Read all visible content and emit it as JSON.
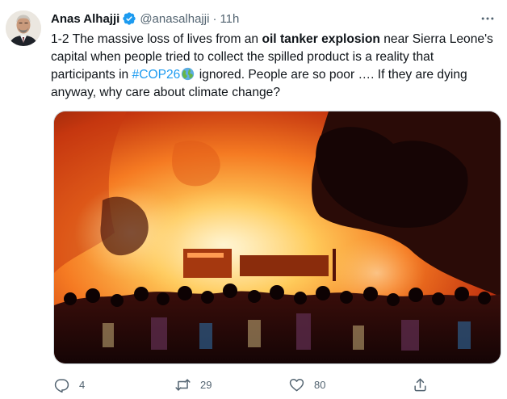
{
  "tweet": {
    "author_name": "Anas Alhajji",
    "handle": "@anasalhajji",
    "separator": "·",
    "time": "11h",
    "text_parts": {
      "p1": "1-2 The massive loss of lives from an ",
      "p2_bold": "oil tanker explosion",
      "p3": " near Sierra Leone's capital when people tried to collect the spilled product is a reality that participants in ",
      "p4_hashtag": "#COP26",
      "p5": " ignored. People are so poor …. If they are dying anyway, why care about climate change?"
    }
  },
  "actions": {
    "reply_count": "4",
    "retweet_count": "29",
    "like_count": "80"
  },
  "icons": {
    "verified": "verified-badge-icon",
    "more": "more-options-icon",
    "globe": "globe-emoji-icon",
    "reply": "reply-icon",
    "retweet": "retweet-icon",
    "like": "heart-icon",
    "share": "share-icon"
  },
  "colors": {
    "text": "#0f1419",
    "secondary": "#536471",
    "link": "#1d9bf0",
    "verified": "#1d9bf0"
  }
}
